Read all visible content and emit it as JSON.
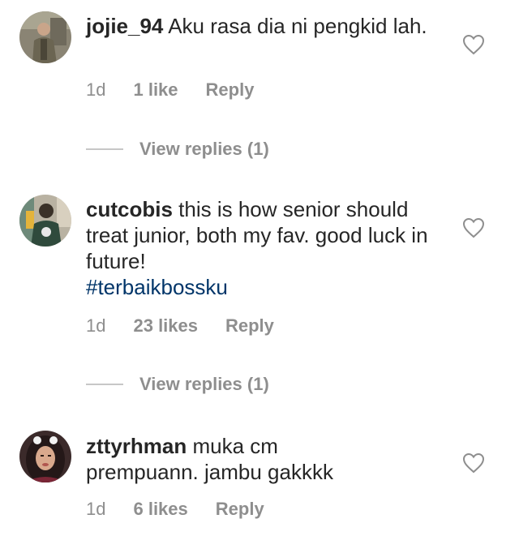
{
  "comments": [
    {
      "username": "jojie_94",
      "text": " Aku rasa dia ni pengkid lah.",
      "time": "1d",
      "likes": "1 like",
      "reply_label": "Reply",
      "view_replies": "View replies (1)"
    },
    {
      "username": "cutcobis",
      "text": " this is how senior should treat junior, both my fav. good luck in future!",
      "hashtag": "#terbaikbossku",
      "time": "1d",
      "likes": "23 likes",
      "reply_label": "Reply",
      "view_replies": "View replies (1)"
    },
    {
      "username": "zttyrhman",
      "text": " muka cm prempuann. jambu gakkkk",
      "time": "1d",
      "likes": "6 likes",
      "reply_label": "Reply"
    }
  ],
  "colors": {
    "text": "#262626",
    "secondary": "#8e8e8e",
    "hashtag": "#003569",
    "divider": "#c7c7c7"
  },
  "icons": {
    "like": "heart-outline-icon"
  }
}
